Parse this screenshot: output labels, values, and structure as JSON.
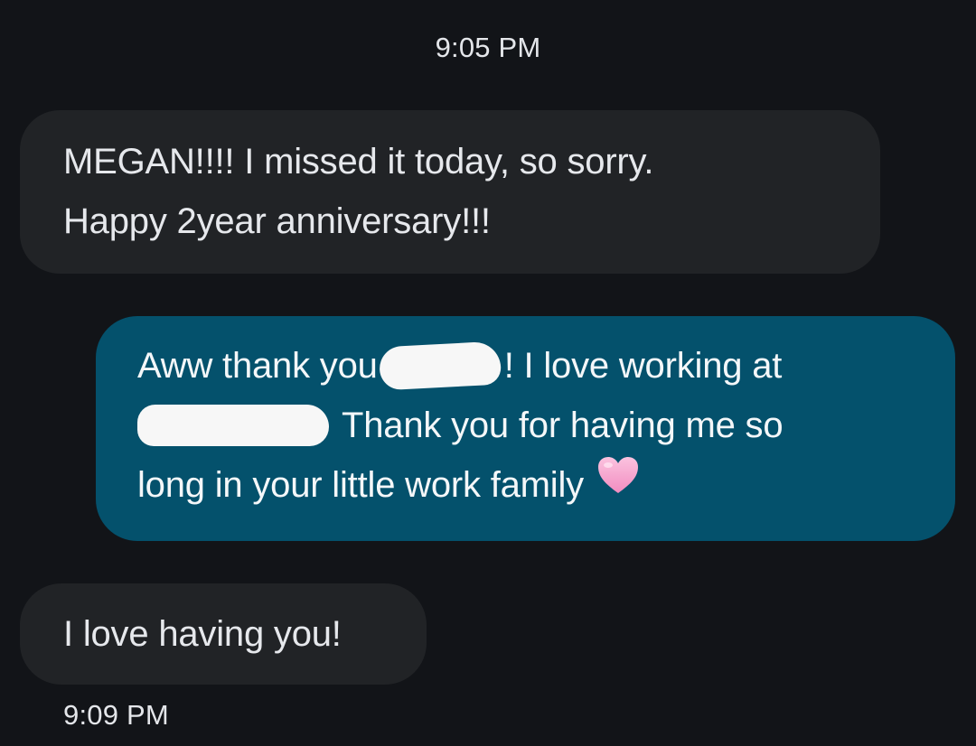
{
  "thread": {
    "timestamp_top": "9:05 PM",
    "timestamp_bottom": "9:09 PM"
  },
  "messages": [
    {
      "direction": "incoming",
      "lines": [
        "MEGAN!!!! I missed it today, so sorry.",
        "Happy 2year anniversary!!!"
      ]
    },
    {
      "direction": "outgoing",
      "line1_before": "Aww thank you",
      "line1_after": "! I love working at",
      "line2_after": "Thank you for having me so",
      "line3": "long in your little work family",
      "emoji": "pink-heart-icon"
    },
    {
      "direction": "incoming",
      "lines": [
        "I love having you!"
      ]
    }
  ],
  "colors": {
    "background": "#121418",
    "incoming_bubble": "#212326",
    "outgoing_bubble": "#04516c",
    "redaction": "#f7f7f7",
    "heart": "#f7a8cf"
  }
}
